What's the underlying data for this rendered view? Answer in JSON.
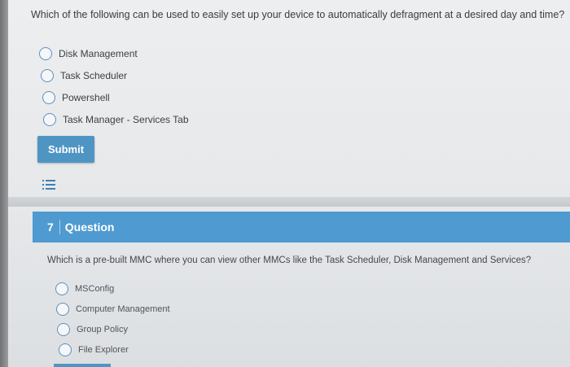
{
  "question1": {
    "text": "Which of the following can be used to easily set up your device to automatically defragment at a desired day and time?",
    "options": [
      "Disk Management",
      "Task Scheduler",
      "Powershell",
      "Task Manager - Services Tab"
    ],
    "submit_label": "Submit",
    "list_icon": "list-icon"
  },
  "question2": {
    "number": "7",
    "header_label": "Question",
    "text": "Which is a pre-built MMC where you can view other MMCs like the Task Scheduler, Disk Management and Services?",
    "options": [
      "MSConfig",
      "Computer Management",
      "Group Policy",
      "File Explorer"
    ]
  },
  "colors": {
    "accent": "#4f9ad0",
    "radio_border": "#5f8fbf",
    "background": "#e8eaec"
  }
}
